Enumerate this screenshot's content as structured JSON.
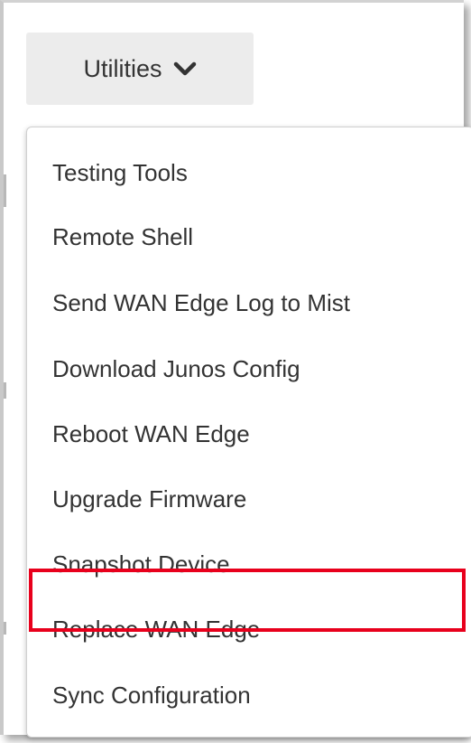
{
  "utilities": {
    "label": "Utilities",
    "icon": "chevron-down-icon"
  },
  "menu": {
    "items": [
      {
        "label": "Testing Tools"
      },
      {
        "label": "Remote Shell"
      },
      {
        "label": "Send WAN Edge Log to Mist"
      },
      {
        "label": "Download Junos Config"
      },
      {
        "label": "Reboot WAN Edge"
      },
      {
        "label": "Upgrade Firmware"
      },
      {
        "label": "Snapshot Device"
      },
      {
        "label": "Replace WAN Edge",
        "highlighted": true
      },
      {
        "label": "Sync Configuration"
      }
    ]
  },
  "colors": {
    "highlight_border": "#e8001c",
    "button_bg": "#ececec",
    "text": "#333333"
  }
}
